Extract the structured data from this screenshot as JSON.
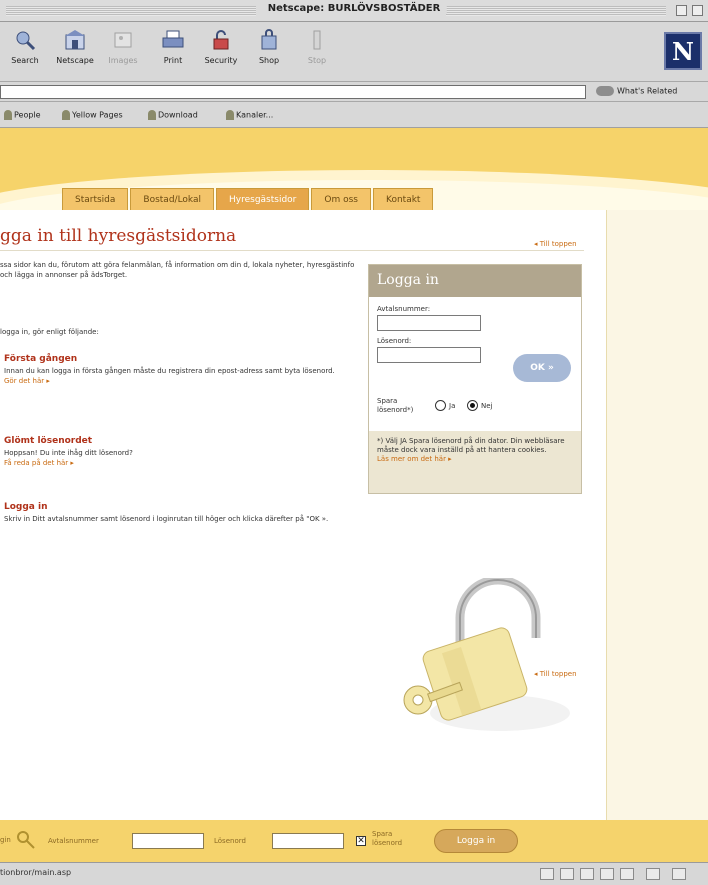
{
  "window": {
    "title": "Netscape: BURLÖVSBOSTÄDER"
  },
  "toolbar": {
    "buttons": [
      {
        "label": "Search"
      },
      {
        "label": "Netscape"
      },
      {
        "label": "Images"
      },
      {
        "label": "Print"
      },
      {
        "label": "Security"
      },
      {
        "label": "Shop"
      },
      {
        "label": "Stop"
      }
    ],
    "logo_letter": "N"
  },
  "location": {
    "value": "",
    "related_label": "What's Related"
  },
  "personal_toolbar": {
    "items": [
      {
        "label": "People"
      },
      {
        "label": "Yellow Pages"
      },
      {
        "label": "Download"
      },
      {
        "label": "Kanaler..."
      }
    ]
  },
  "nav": {
    "tabs": [
      {
        "label": "Startsida",
        "active": false
      },
      {
        "label": "Bostad/Lokal",
        "active": false
      },
      {
        "label": "Hyresgästsidor",
        "active": true
      },
      {
        "label": "Om oss",
        "active": false
      },
      {
        "label": "Kontakt",
        "active": false
      }
    ]
  },
  "main": {
    "title": "gga in till hyresgästsidorna",
    "top_link": "◂ Till toppen",
    "intro": "ssa sidor kan du, förutom att göra felanmälan, få information om din d, lokala nyheter, hyresgästinfo och lägga in annonser på ädsTorget.",
    "instruction": "logga in, gör enligt följande:",
    "sections": [
      {
        "heading": "Första gången",
        "text": "Innan du kan logga in första gången måste du registrera din epost-adress samt byta lösenord.",
        "link": "Gör det här ▸"
      },
      {
        "heading": "Glömt lösenordet",
        "text": "Hoppsan! Du inte ihåg ditt lösenord?",
        "link": "Få reda på det här ▸"
      },
      {
        "heading": "Logga in",
        "text": "Skriv in Ditt avtalsnummer samt lösenord i loginrutan till höger och klicka därefter på \"OK ».",
        "link": ""
      }
    ],
    "bottom_link": "◂ Till toppen"
  },
  "login": {
    "header": "Logga in",
    "avtal_label": "Avtalsnummer:",
    "pass_label": "Lösenord:",
    "ok_label": "OK »",
    "spara_label": "Spara lösenord*)",
    "ja_label": "Ja",
    "nej_label": "Nej",
    "remember": "nej",
    "note": "*) Välj JA Spara lösenord på din dator. Din webbläsare måste dock vara inställd på att hantera cookies.",
    "note_link": "Läs mer om det här ▸"
  },
  "footer": {
    "login_label": "gin",
    "avtal_label": "Avtalsnummer",
    "pass_label": "Lösenord",
    "spara_label": "Spara lösenord",
    "spara_checked": true,
    "button_label": "Logga in"
  },
  "status": {
    "text": "tionbror/main.asp"
  },
  "colors": {
    "accent": "#b0321a",
    "band": "#f6d36a",
    "link": "#c96b12"
  }
}
